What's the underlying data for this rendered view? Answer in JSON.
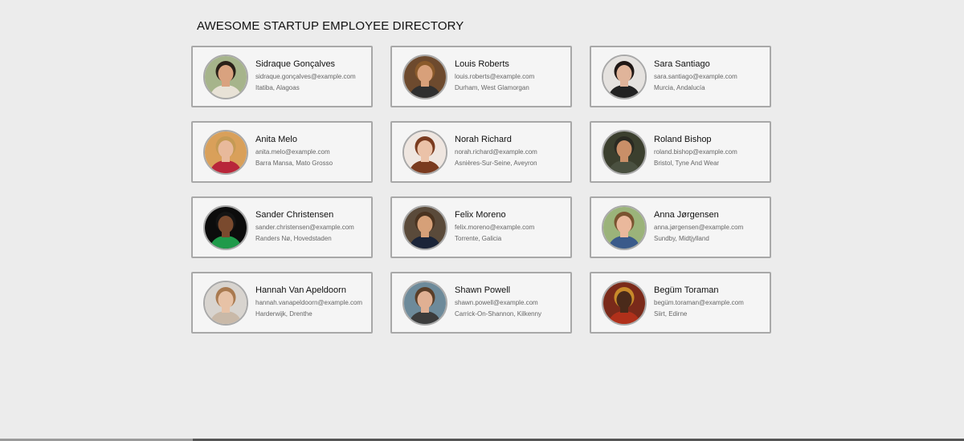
{
  "header": {
    "title": "AWESOME STARTUP EMPLOYEE DIRECTORY"
  },
  "employees": [
    {
      "name": "Sidraque Gonçalves",
      "email": "sidraque.gonçalves@example.com",
      "location": "Itatiba, Alagoas",
      "avatar_bg": "#a6b48b",
      "avatar_fg": "#d9a27f",
      "avatar_hair": "#2a2018",
      "avatar_shirt": "#e8e2d6"
    },
    {
      "name": "Louis Roberts",
      "email": "louis.roberts@example.com",
      "location": "Durham, West Glamorgan",
      "avatar_bg": "#6d4a2e",
      "avatar_fg": "#d8a07a",
      "avatar_hair": "#8a5a2b",
      "avatar_shirt": "#2f2f2f"
    },
    {
      "name": "Sara Santiago",
      "email": "sara.santiago@example.com",
      "location": "Murcia, Andalucía",
      "avatar_bg": "#e5e2df",
      "avatar_fg": "#e0b49a",
      "avatar_hair": "#1f1715",
      "avatar_shirt": "#222222"
    },
    {
      "name": "Anita Melo",
      "email": "anita.melo@example.com",
      "location": "Barra Mansa, Mato Grosso",
      "avatar_bg": "#d9a05a",
      "avatar_fg": "#e8b99b",
      "avatar_hair": "#c59a54",
      "avatar_shirt": "#b8263a"
    },
    {
      "name": "Norah Richard",
      "email": "norah.richard@example.com",
      "location": "Asnières-Sur-Seine, Aveyron",
      "avatar_bg": "#efe6e0",
      "avatar_fg": "#ebc2a8",
      "avatar_hair": "#7a3b1f",
      "avatar_shirt": "#7a3b1f"
    },
    {
      "name": "Roland Bishop",
      "email": "roland.bishop@example.com",
      "location": "Bristol, Tyne And Wear",
      "avatar_bg": "#3b3f2e",
      "avatar_fg": "#c98f68",
      "avatar_hair": "#2a2a22",
      "avatar_shirt": "#4a5040"
    },
    {
      "name": "Sander Christensen",
      "email": "sander.christensen@example.com",
      "location": "Randers Nø, Hovedstaden",
      "avatar_bg": "#0c0c0c",
      "avatar_fg": "#7a4a2e",
      "avatar_hair": "#141414",
      "avatar_shirt": "#1f9a4a"
    },
    {
      "name": "Felix Moreno",
      "email": "felix.moreno@example.com",
      "location": "Torrente, Galicia",
      "avatar_bg": "#5a4a3a",
      "avatar_fg": "#d6a078",
      "avatar_hair": "#4a3320",
      "avatar_shirt": "#1b2438"
    },
    {
      "name": "Anna Jørgensen",
      "email": "anna.jørgensen@example.com",
      "location": "Sundby, Midtjylland",
      "avatar_bg": "#9bb37a",
      "avatar_fg": "#eab89c",
      "avatar_hair": "#7a5330",
      "avatar_shirt": "#3a5a8a"
    },
    {
      "name": "Hannah Van Apeldoorn",
      "email": "hannah.vanapeldoorn@example.com",
      "location": "Harderwijk, Drenthe",
      "avatar_bg": "#d8d4cf",
      "avatar_fg": "#e7c2a6",
      "avatar_hair": "#a97a50",
      "avatar_shirt": "#c9b9a8"
    },
    {
      "name": "Shawn Powell",
      "email": "shawn.powell@example.com",
      "location": "Carrick-On-Shannon, Kilkenny",
      "avatar_bg": "#6d8a9a",
      "avatar_fg": "#e0b093",
      "avatar_hair": "#5a3e28",
      "avatar_shirt": "#3c3c3c"
    },
    {
      "name": "Begüm Toraman",
      "email": "begüm.toraman@example.com",
      "location": "Siirt, Edirne",
      "avatar_bg": "#7a2a1a",
      "avatar_fg": "#4a2a1a",
      "avatar_hair": "#c88a2a",
      "avatar_shirt": "#b0301a"
    }
  ]
}
